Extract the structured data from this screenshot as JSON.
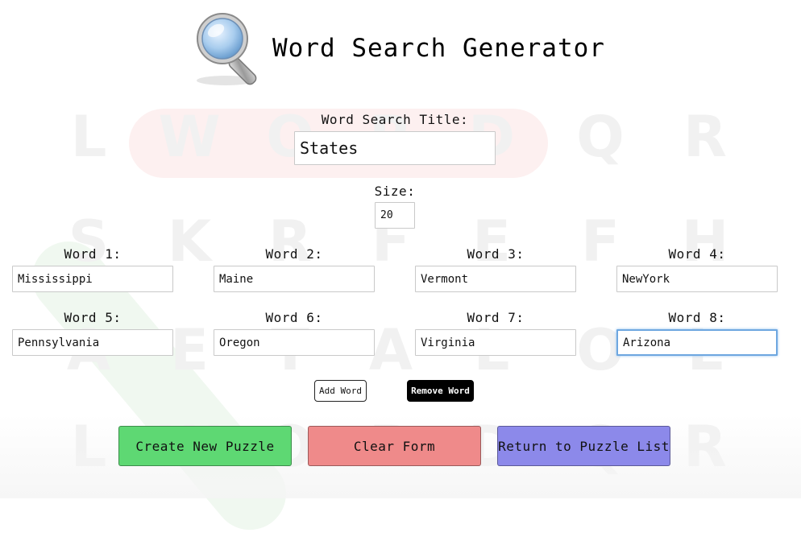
{
  "app": {
    "title": "Word Search Generator",
    "logo_icon": "magnifying-glass-icon"
  },
  "background": {
    "rows": [
      [
        "L",
        "W",
        "O",
        "R",
        "D",
        "Q",
        "R"
      ],
      [
        "S",
        "K",
        "R",
        "F",
        "E",
        "F",
        "H"
      ],
      [
        "A",
        "E",
        "T",
        "A",
        "L",
        "O",
        "L"
      ],
      [
        "L",
        "W",
        "O",
        "R",
        "D",
        "Q",
        "R"
      ]
    ],
    "highlight_colors": [
      "#fdeeee",
      "#eef7ee"
    ]
  },
  "form": {
    "title_label": "Word Search Title:",
    "title_value": "States",
    "size_label": "Size:",
    "size_value": "20",
    "words": [
      {
        "label": "Word 1:",
        "value": "Mississippi"
      },
      {
        "label": "Word 2:",
        "value": "Maine"
      },
      {
        "label": "Word 3:",
        "value": "Vermont"
      },
      {
        "label": "Word 4:",
        "value": "NewYork"
      },
      {
        "label": "Word 5:",
        "value": "Pennsylvania"
      },
      {
        "label": "Word 6:",
        "value": "Oregon"
      },
      {
        "label": "Word 7:",
        "value": "Virginia"
      },
      {
        "label": "Word 8:",
        "value": "Arizona"
      }
    ],
    "focused_word": 8
  },
  "buttons": {
    "add_word": "Add Word",
    "remove_word": "Remove Word",
    "create": "Create New Puzzle",
    "clear": "Clear Form",
    "return": "Return to Puzzle List"
  },
  "colors": {
    "create": "#5ed873",
    "clear": "#ef8a8a",
    "return": "#8c89ea",
    "focus": "#6ea7e0"
  }
}
